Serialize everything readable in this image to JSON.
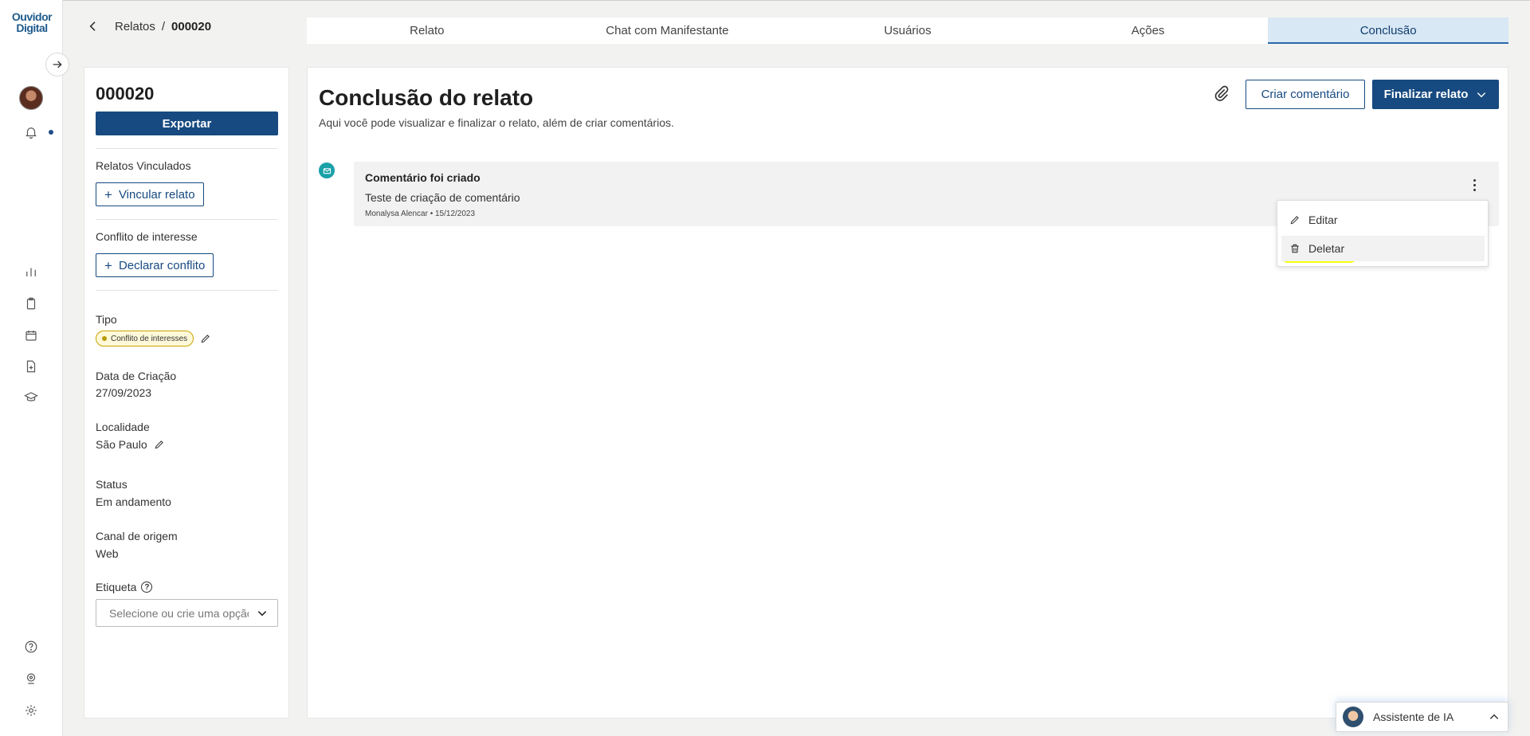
{
  "app": {
    "logo_line1": "Ouvidor",
    "logo_line2": "Digital"
  },
  "breadcrumb": {
    "parent": "Relatos",
    "separator": "/",
    "current": "000020"
  },
  "tabs": [
    {
      "label": "Relato"
    },
    {
      "label": "Chat com Manifestante"
    },
    {
      "label": "Usuários"
    },
    {
      "label": "Ações"
    },
    {
      "label": "Conclusão"
    }
  ],
  "active_tab": "Conclusão",
  "side": {
    "relato_id": "000020",
    "export_label": "Exportar",
    "linked_label": "Relatos Vinculados",
    "link_button": "Vincular relato",
    "conflict_label": "Conflito de interesse",
    "conflict_button": "Declarar conflito",
    "tipo_label": "Tipo",
    "tipo_value": "Conflito de interesses",
    "created_label": "Data de Criação",
    "created_value": "27/09/2023",
    "location_label": "Localidade",
    "location_value": "São Paulo",
    "status_label": "Status",
    "status_value": "Em andamento",
    "channel_label": "Canal de origem",
    "channel_value": "Web",
    "tag_label": "Etiqueta",
    "tag_placeholder": "Selecione ou crie uma opção"
  },
  "main": {
    "title": "Conclusão do relato",
    "subtitle": "Aqui você pode visualizar e finalizar o relato, além de criar comentários.",
    "comment_button": "Criar comentário",
    "finalize_button": "Finalizar relato"
  },
  "event": {
    "title": "Comentário foi criado",
    "body": "Teste de criação de comentário",
    "meta": "Monalysa Alencar • 15/12/2023"
  },
  "menu": {
    "edit": "Editar",
    "delete": "Deletar"
  },
  "assistant": {
    "label": "Assistente de IA"
  },
  "colors": {
    "primary": "#174a80",
    "active_tab_bg": "#d9e8f5",
    "timeline_icon": "#1aa1a8",
    "highlight": "#f2ff00"
  }
}
